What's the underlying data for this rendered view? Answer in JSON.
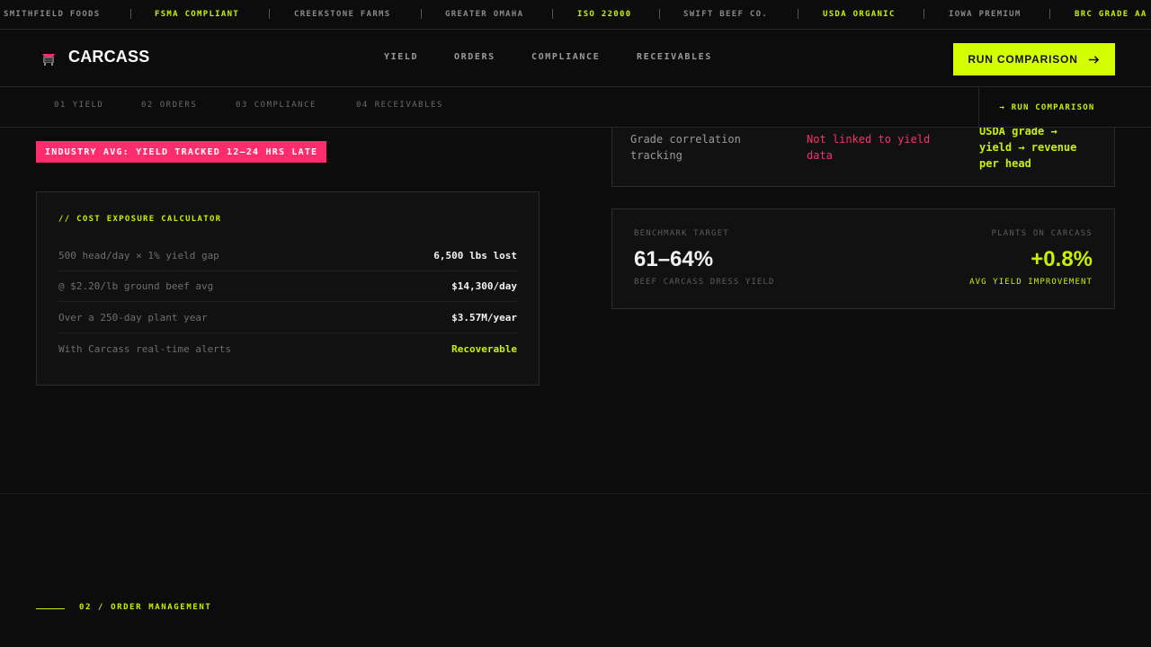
{
  "ticker": {
    "items": [
      {
        "label": "SMITHFIELD FOODS",
        "highlight": false
      },
      {
        "label": "FSMA COMPLIANT",
        "highlight": true
      },
      {
        "label": "CREEKSTONE FARMS",
        "highlight": false
      },
      {
        "label": "GREATER OMAHA",
        "highlight": false
      },
      {
        "label": "ISO 22000",
        "highlight": true
      },
      {
        "label": "SWIFT BEEF CO.",
        "highlight": false
      },
      {
        "label": "USDA ORGANIC",
        "highlight": true
      },
      {
        "label": "IOWA PREMIUM",
        "highlight": false
      },
      {
        "label": "BRC GRADE AA",
        "highlight": true
      }
    ]
  },
  "nav": {
    "logo": "CARCASS",
    "links": [
      "YIELD",
      "ORDERS",
      "COMPLIANCE",
      "RECEIVABLES"
    ],
    "cta": "RUN COMPARISON"
  },
  "subnav": {
    "links": [
      "01 YIELD",
      "02 ORDERS",
      "03 COMPLIANCE",
      "04 RECEIVABLES"
    ],
    "cta": "→ RUN COMPARISON"
  },
  "badge": "INDUSTRY AVG: YIELD TRACKED 12–24 HRS LATE",
  "calculator": {
    "title": "// COST EXPOSURE CALCULATOR",
    "rows": [
      {
        "label": "500 head/day × 1% yield gap",
        "value": "6,500 lbs lost"
      },
      {
        "label": "@ $2.20/lb ground beef avg",
        "value": "$14,300/day"
      },
      {
        "label": "Over a 250-day plant year",
        "value": "$3.57M/year"
      },
      {
        "label": "With Carcass real-time alerts",
        "value": "Recoverable"
      }
    ]
  },
  "comparison": {
    "label": "Grade correlation tracking",
    "industry": "Not linked to yield data",
    "carcass": "USDA grade → yield → revenue per head"
  },
  "benchmark": {
    "target_label": "BENCHMARK TARGET",
    "target_value": "61–64%",
    "target_sub": "BEEF CARCASS DRESS YIELD",
    "plants_label": "PLANTS ON CARCASS",
    "plants_value": "+0.8%",
    "plants_sub": "AVG YIELD IMPROVEMENT"
  },
  "next_section": "02 / ORDER MANAGEMENT",
  "colors": {
    "accent": "#d4ff00",
    "alert": "#ff2d6e",
    "background": "#0c0c0c"
  }
}
